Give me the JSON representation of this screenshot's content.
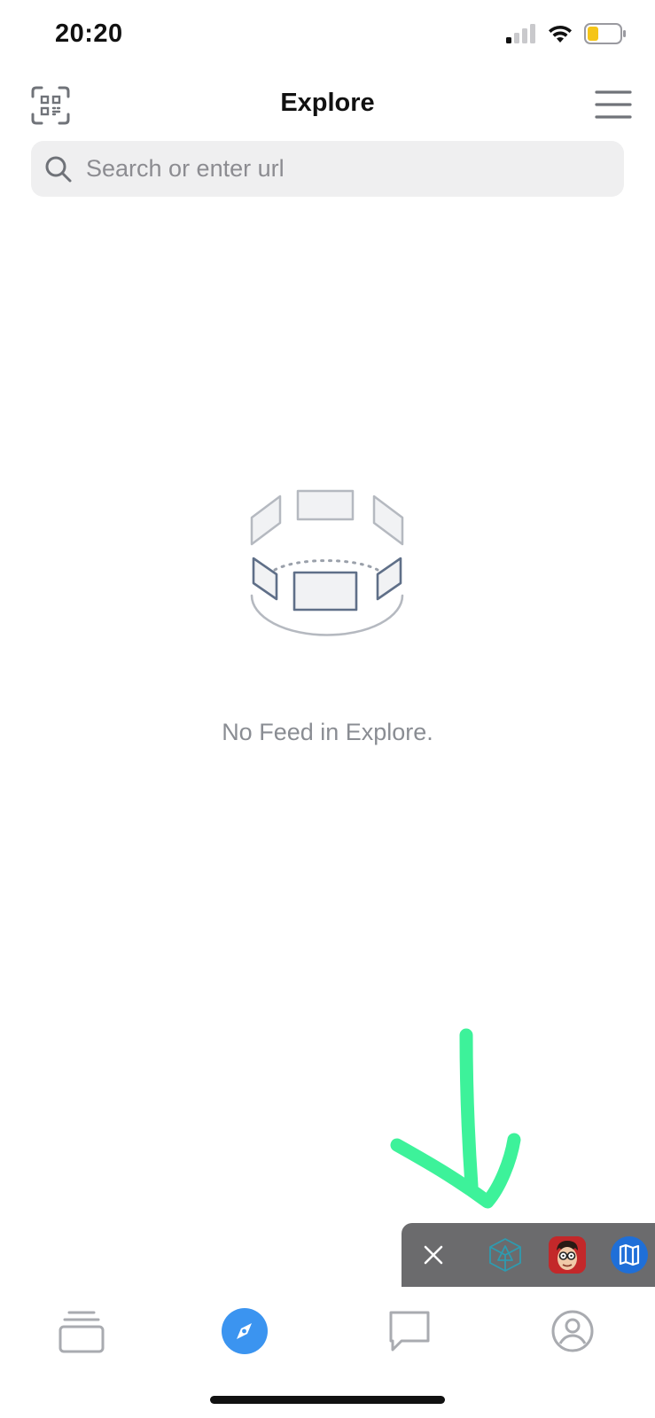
{
  "status_bar": {
    "time": "20:20",
    "icons": [
      "cellular-signal-icon",
      "wifi-icon",
      "battery-icon"
    ]
  },
  "header": {
    "title": "Explore",
    "left_icon": "qr-scan-icon",
    "right_icon": "menu-icon"
  },
  "search": {
    "placeholder": "Search or enter url",
    "icon": "search-icon"
  },
  "empty_state": {
    "illustration": "empty-feed-illustration",
    "message": "No Feed in Explore."
  },
  "dapp_tray": {
    "close_icon": "close-icon",
    "apps": [
      "cube-dapp-icon",
      "avatar-dapp-icon",
      "map-dapp-icon"
    ]
  },
  "tab_bar": {
    "tabs": [
      {
        "icon": "wallet-stack-icon",
        "active": false
      },
      {
        "icon": "compass-icon",
        "active": true
      },
      {
        "icon": "chat-icon",
        "active": false
      },
      {
        "icon": "profile-icon",
        "active": false
      }
    ]
  },
  "colors": {
    "accent": "#3b94f0",
    "annotation": "#3df29a",
    "tray_background": "#6b6b6d",
    "search_background": "#efeff0",
    "muted_text": "#8a8d93"
  }
}
